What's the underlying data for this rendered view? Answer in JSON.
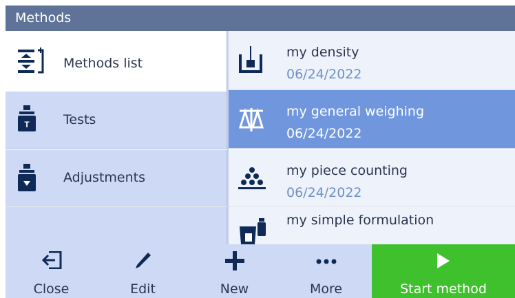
{
  "window": {
    "title": "Methods"
  },
  "nav": {
    "items": [
      {
        "label": "Methods list",
        "icon": "methods-list-icon"
      },
      {
        "label": "Tests",
        "icon": "test-weight-icon"
      },
      {
        "label": "Adjustments",
        "icon": "adjustment-weight-icon"
      }
    ]
  },
  "methods": [
    {
      "name": "my density",
      "date": "06/24/2022",
      "icon": "density-icon"
    },
    {
      "name": "my general weighing",
      "date": "06/24/2022",
      "icon": "scale-icon"
    },
    {
      "name": "my piece counting",
      "date": "06/24/2022",
      "icon": "piece-counting-icon"
    },
    {
      "name": "my simple formulation",
      "icon": "formulation-icon"
    }
  ],
  "toolbar": {
    "close_label": "Close",
    "edit_label": "Edit",
    "new_label": "New",
    "more_label": "More",
    "start_label": "Start method"
  },
  "colors": {
    "title_bg": "#5f7399",
    "selected": "#7096dd",
    "start": "#3fc12d",
    "icon": "#0f2a56"
  }
}
